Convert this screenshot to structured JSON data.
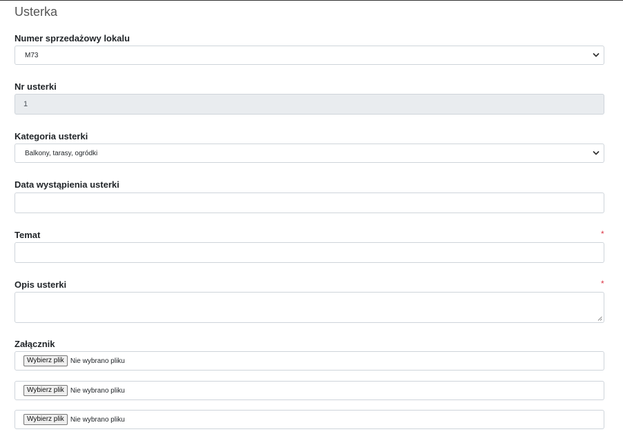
{
  "form": {
    "title": "Usterka",
    "sale_number": {
      "label": "Numer sprzedażowy lokalu",
      "value": "M73"
    },
    "defect_no": {
      "label": "Nr usterki",
      "value": "1"
    },
    "category": {
      "label": "Kategoria usterki",
      "value": "Balkony, tarasy, ogródki"
    },
    "date": {
      "label": "Data wystąpienia usterki",
      "value": ""
    },
    "subject": {
      "label": "Temat",
      "required_mark": "*",
      "value": ""
    },
    "description": {
      "label": "Opis usterki",
      "required_mark": "*",
      "value": ""
    },
    "attachments": {
      "label": "Załącznik",
      "items": [
        {
          "button": "Wybierz plik",
          "status": "Nie wybrano pliku"
        },
        {
          "button": "Wybierz plik",
          "status": "Nie wybrano pliku"
        },
        {
          "button": "Wybierz plik",
          "status": "Nie wybrano pliku"
        }
      ]
    }
  },
  "icons": {
    "select_arrow": "chevron-down-icon",
    "resize": "resize-handle-icon"
  },
  "colors": {
    "required": "#dc3545",
    "readonly_bg": "#e9ecef",
    "border": "#ced4da"
  }
}
